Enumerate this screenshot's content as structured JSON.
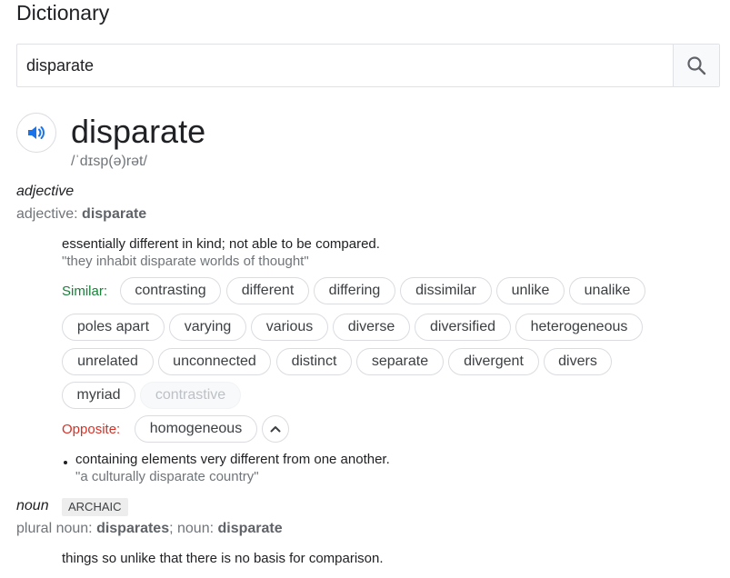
{
  "app_title": "Dictionary",
  "search": {
    "value": "disparate"
  },
  "entry": {
    "word": "disparate",
    "phonetic": "/ˈdɪsp(ə)rət/",
    "adjective": {
      "pos": "adjective",
      "forms_label": "adjective: ",
      "forms_word": "disparate",
      "definition1": "essentially different in kind; not able to be compared.",
      "example1": "\"they inhabit disparate worlds of thought\"",
      "similar_label": "Similar:",
      "similar": [
        "contrasting",
        "different",
        "differing",
        "dissimilar",
        "unlike",
        "unalike",
        "poles apart",
        "varying",
        "various",
        "diverse",
        "diversified",
        "heterogeneous",
        "unrelated",
        "unconnected",
        "distinct",
        "separate",
        "divergent",
        "divers",
        "myriad",
        "contrastive"
      ],
      "opposite_label": "Opposite:",
      "opposite": [
        "homogeneous"
      ],
      "definition2": "containing elements very different from one another.",
      "example2": "\"a culturally disparate country\""
    },
    "noun": {
      "pos": "noun",
      "tag": "ARCHAIC",
      "forms_label1": "plural noun: ",
      "forms_word1": "disparates",
      "forms_sep": "; noun: ",
      "forms_word2": "disparate",
      "definition1": "things so unlike that there is no basis for comparison."
    }
  },
  "icons": {
    "search": "search-icon",
    "speaker": "speaker-icon",
    "collapse": "chevron-up-icon"
  }
}
